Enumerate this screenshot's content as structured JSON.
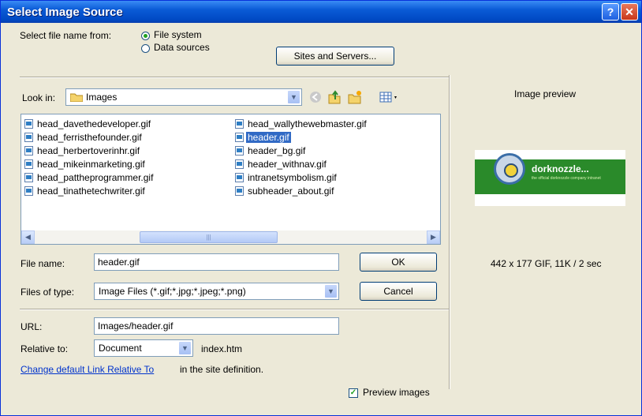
{
  "window": {
    "title": "Select Image Source",
    "help_glyph": "?",
    "close_glyph": "✕"
  },
  "select_from": {
    "label": "Select file name from:",
    "options": [
      {
        "label": "File system",
        "selected": true
      },
      {
        "label": "Data sources",
        "selected": false
      }
    ],
    "sites_button": "Sites and Servers..."
  },
  "look_in": {
    "label": "Look in:",
    "value": "Images"
  },
  "files": {
    "column1": [
      "head_davethedeveloper.gif",
      "head_ferristhefounder.gif",
      "head_herbertoverinhr.gif",
      "head_mikeinmarketing.gif",
      "head_pattheprogrammer.gif",
      "head_tinathetechwriter.gif"
    ],
    "column2": [
      "head_wallythewebmaster.gif",
      "header.gif",
      "header_bg.gif",
      "header_withnav.gif",
      "intranetsymbolism.gif",
      "subheader_about.gif"
    ],
    "selected": "header.gif"
  },
  "file_name": {
    "label": "File name:",
    "value": "header.gif"
  },
  "files_of_type": {
    "label": "Files of type:",
    "value": "Image Files (*.gif;*.jpg;*.jpeg;*.png)"
  },
  "buttons": {
    "ok": "OK",
    "cancel": "Cancel"
  },
  "url": {
    "label": "URL:",
    "value": "Images/header.gif"
  },
  "relative_to": {
    "label": "Relative to:",
    "value": "Document",
    "file": "index.htm"
  },
  "change_link": {
    "link_text": "Change default Link Relative To",
    "rest": "in the site definition."
  },
  "preview_images": {
    "label": "Preview images",
    "checked": true
  },
  "preview": {
    "title": "Image preview",
    "info": "442 x 177 GIF, 11K / 2 sec",
    "brand": "dorknozzle...",
    "tagline": "the official dorknozzle company intranet"
  },
  "colors": {
    "title_bar": "#0a5bd6",
    "selection": "#316ac5",
    "link": "#0033cc",
    "dialog_bg": "#ece9d8"
  }
}
